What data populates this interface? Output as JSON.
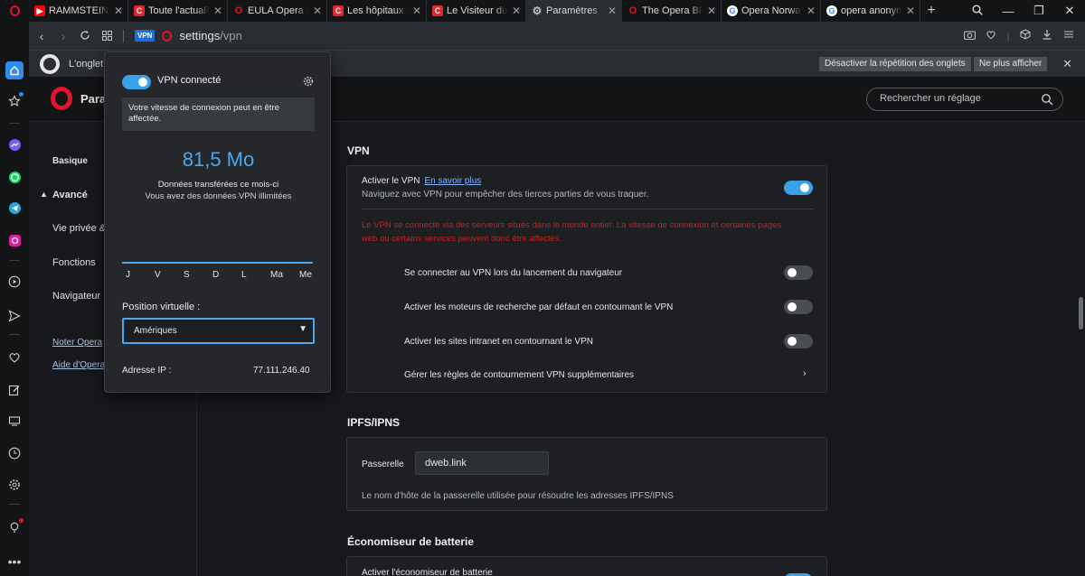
{
  "tabs": [
    {
      "title": "RAMMSTEIN",
      "favicon": "youtube-icon",
      "color": "#ff0000"
    },
    {
      "title": "Toute l'actualité",
      "favicon": "c-icon",
      "color": "#e2262b"
    },
    {
      "title": "EULA Opera for",
      "favicon": "opera-icon",
      "color": "#e0142b"
    },
    {
      "title": "Les hôpitaux du",
      "favicon": "c-icon",
      "color": "#e2262b"
    },
    {
      "title": "Le Visiteur du Fu",
      "favicon": "c-icon",
      "color": "#e2262b"
    },
    {
      "title": "Paramètres",
      "favicon": "gear-icon",
      "color": "#bfbfbf",
      "active": true
    },
    {
      "title": "The Opera Blog",
      "favicon": "opera-icon",
      "color": "#e0142b"
    },
    {
      "title": "Opera Norway A",
      "favicon": "google-icon",
      "color": "#4285f4"
    },
    {
      "title": "opera anonymat",
      "favicon": "google-icon",
      "color": "#4285f4"
    }
  ],
  "address": {
    "vpn_badge": "VPN",
    "url_host": "settings",
    "url_path": "/vpn"
  },
  "infobar": {
    "message": "L'onglet a",
    "btn_disable": "Désactiver la répétition des onglets",
    "btn_never": "Ne plus afficher"
  },
  "header": {
    "title": "Para",
    "search_placeholder": "Rechercher un réglage"
  },
  "nav": {
    "basique": "Basique",
    "avance": "Avancé",
    "vie_privee": "Vie privée &",
    "fonctions": "Fonctions",
    "navigateur": "Navigateur",
    "noter": "Noter Opera",
    "aide": "Aide d'Opera"
  },
  "vpn_section": {
    "title": "VPN",
    "enable_label": "Activer le VPN",
    "learn_more": "En savoir plus",
    "enable_sub": "Naviguez avec VPN pour empêcher des tierces parties de vous traquer.",
    "enable_on": true,
    "warning_1": "Le VPN se connecte via des serveurs situés dans le monde entier. La vitesse de connexion et certaines pages",
    "warning_2": "web ou certains services peuvent donc être affectés.",
    "opt_startup": "Se connecter au VPN lors du lancement du navigateur",
    "opt_search": "Activer les moteurs de recherche par défaut en contournant le VPN",
    "opt_intranet": "Activer les sites intranet en contournant le VPN",
    "opt_rules": "Gérer les règles de contournement VPN supplémentaires"
  },
  "ipfs_section": {
    "title": "IPFS/IPNS",
    "gateway_label": "Passerelle",
    "gateway_value": "dweb.link",
    "gateway_help": "Le nom d'hôte de la passerelle utilisée pour résoudre les adresses IPFS/IPNS"
  },
  "battery_section": {
    "title": "Économiseur de batterie",
    "enable_label": "Activer l'économiseur de batterie"
  },
  "vpn_popup": {
    "status": "VPN connecté",
    "notice": "Votre vitesse de connexion peut en être affectée.",
    "data_value": "81,5 Mo",
    "data_label": "Données transférées ce mois-ci",
    "data_unlimited": "Vous avez des données VPN illimitées",
    "days": [
      "J",
      "V",
      "S",
      "D",
      "L",
      "Ma",
      "Me"
    ],
    "position_label": "Position virtuelle :",
    "position_value": "Amériques",
    "ip_label": "Adresse IP :",
    "ip_value": "77.111.246.40"
  },
  "colors": {
    "accent": "#3aa0e8",
    "opera_red": "#e0142b",
    "warning": "#c02323"
  }
}
